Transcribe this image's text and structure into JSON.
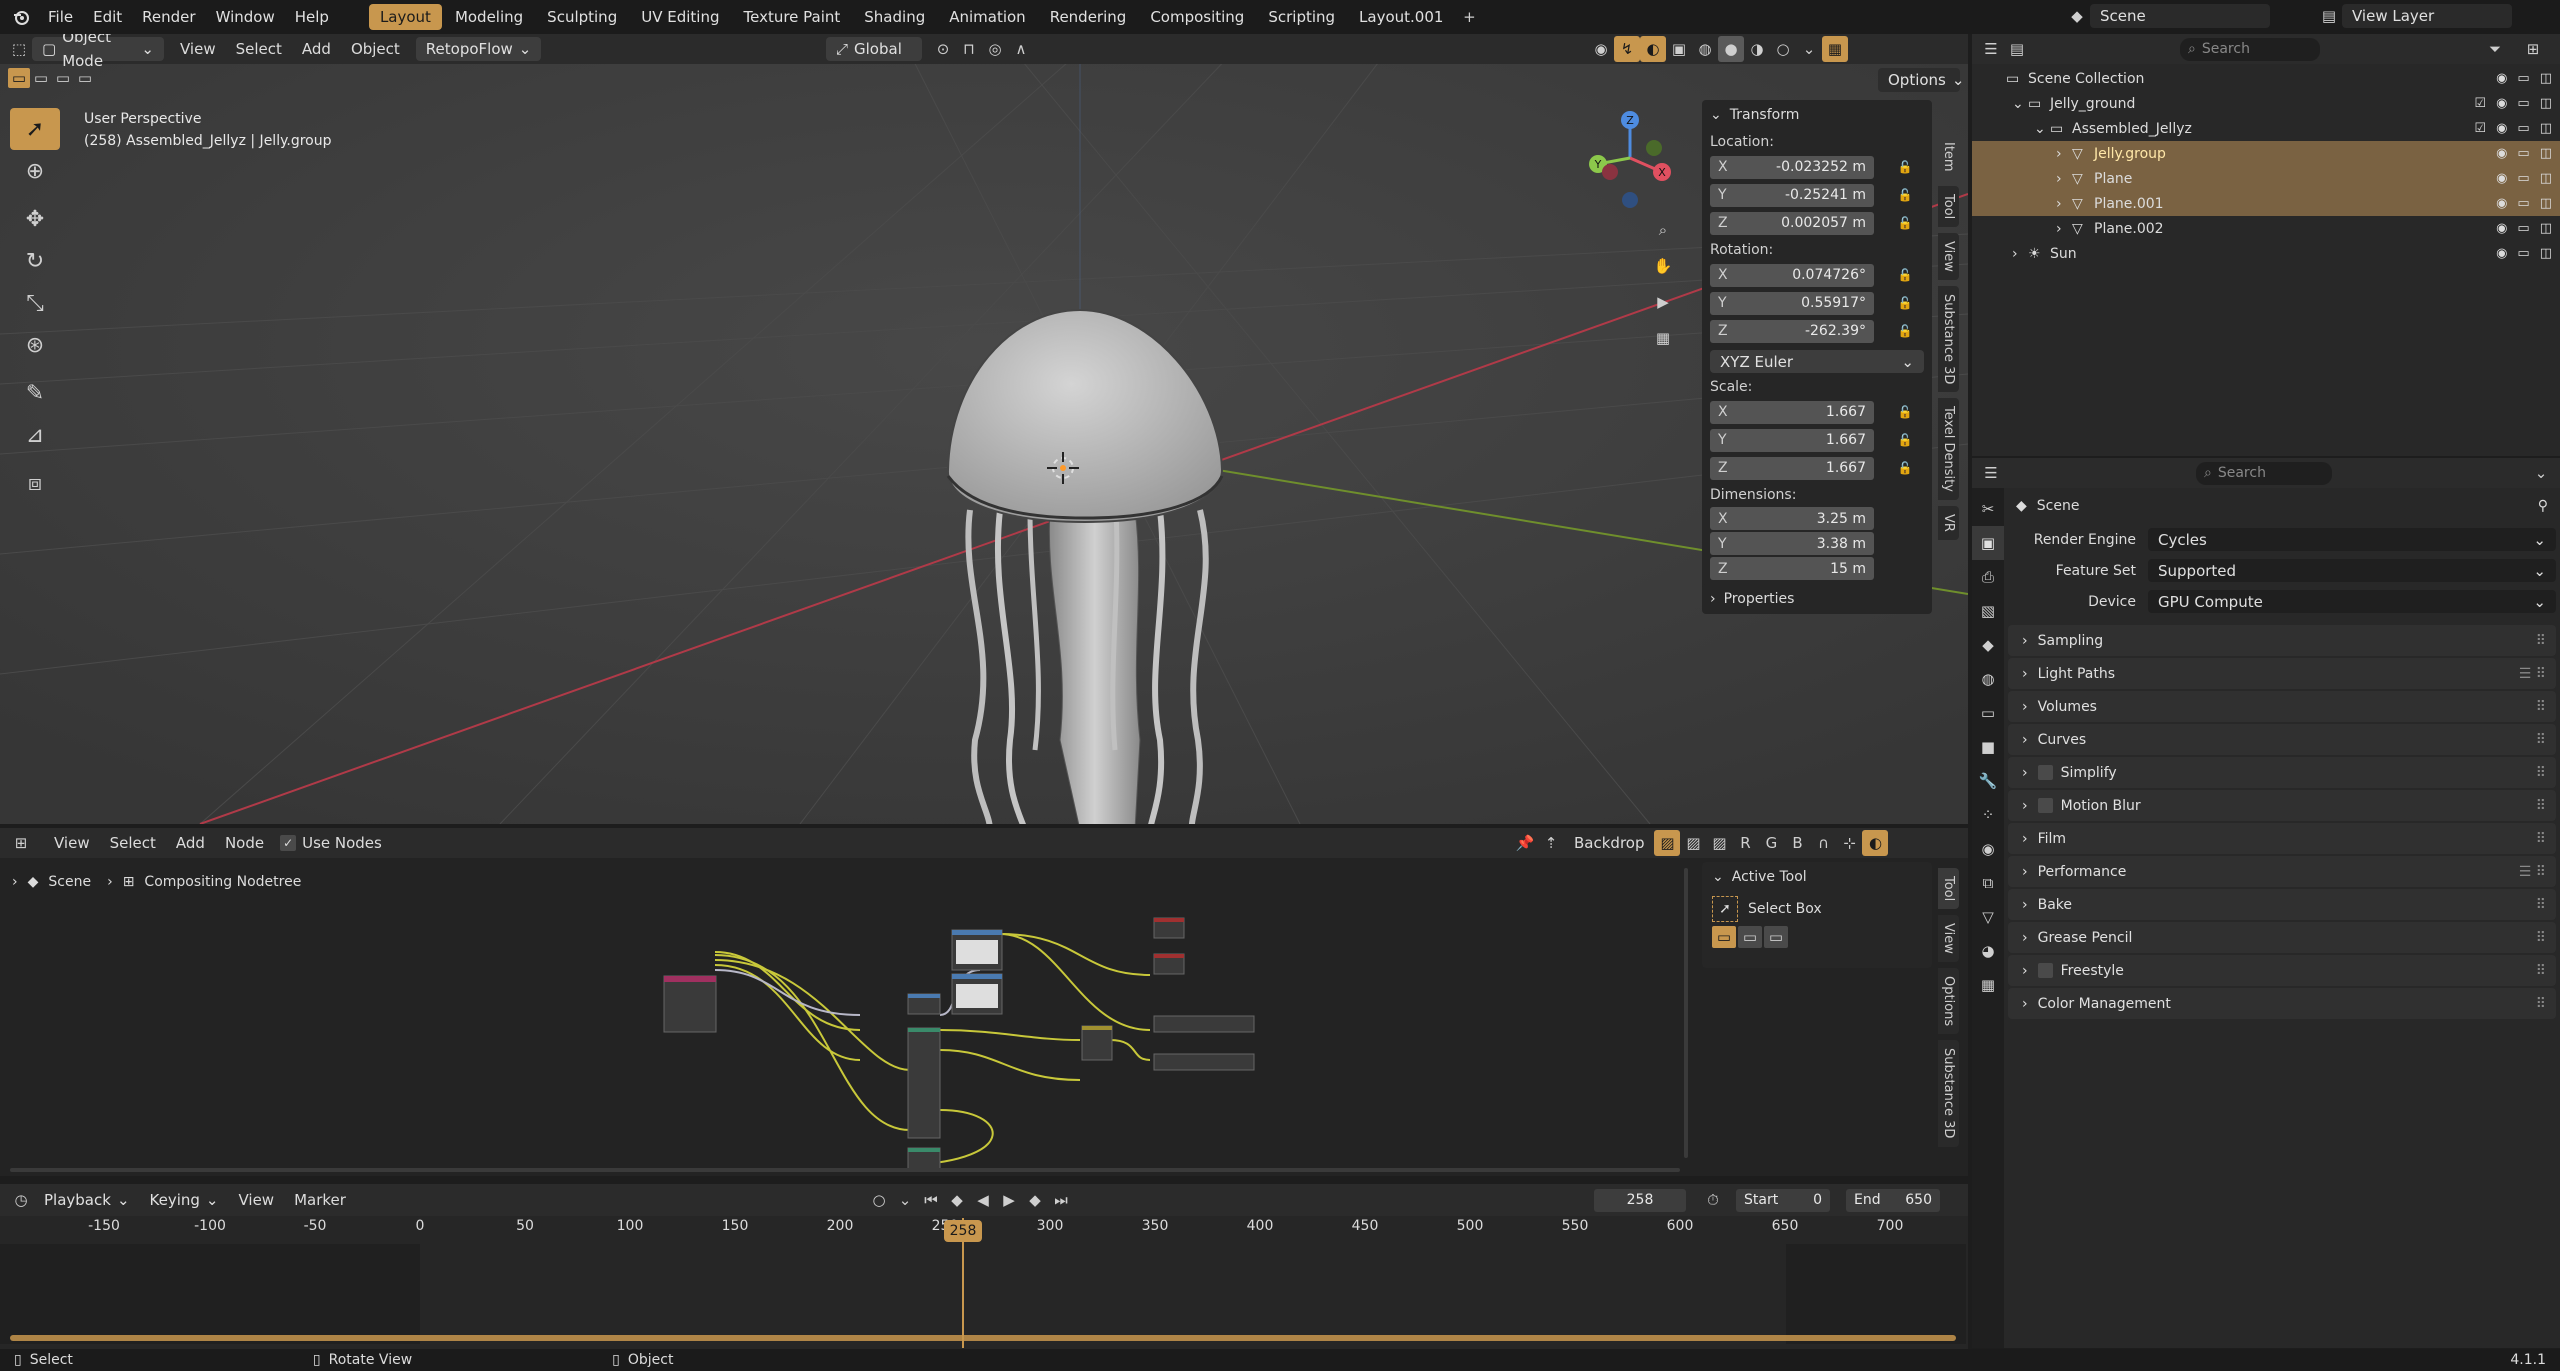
{
  "menu": [
    "File",
    "Edit",
    "Render",
    "Window",
    "Help"
  ],
  "workspaces": [
    "Layout",
    "Modeling",
    "Sculpting",
    "UV Editing",
    "Texture Paint",
    "Shading",
    "Animation",
    "Rendering",
    "Compositing",
    "Scripting",
    "Layout.001"
  ],
  "scene_selector": {
    "label": "Scene"
  },
  "viewlayer_selector": {
    "label": "View Layer"
  },
  "viewport": {
    "mode": "Object Mode",
    "menus": [
      "View",
      "Select",
      "Add",
      "Object"
    ],
    "addon_menu": "RetopoFlow",
    "orientation": "Global",
    "options": "Options",
    "info_line1": "User Perspective",
    "info_line2": "(258) Assembled_Jellyz | Jelly.group",
    "side_tabs": [
      "Item",
      "Tool",
      "View",
      "Substance 3D",
      "Texel Density",
      "VR"
    ],
    "gizmo": {
      "x": "X",
      "y": "Y",
      "z": "Z"
    }
  },
  "transform": {
    "title": "Transform",
    "location_label": "Location:",
    "location": [
      {
        "ax": "X",
        "v": "-0.023252 m"
      },
      {
        "ax": "Y",
        "v": "-0.25241 m"
      },
      {
        "ax": "Z",
        "v": "0.002057 m"
      }
    ],
    "rotation_label": "Rotation:",
    "rotation": [
      {
        "ax": "X",
        "v": "0.074726°"
      },
      {
        "ax": "Y",
        "v": "0.55917°"
      },
      {
        "ax": "Z",
        "v": "-262.39°"
      }
    ],
    "rotation_mode": "XYZ Euler",
    "scale_label": "Scale:",
    "scale": [
      {
        "ax": "X",
        "v": "1.667"
      },
      {
        "ax": "Y",
        "v": "1.667"
      },
      {
        "ax": "Z",
        "v": "1.667"
      }
    ],
    "dimensions_label": "Dimensions:",
    "dimensions": [
      {
        "ax": "X",
        "v": "3.25 m"
      },
      {
        "ax": "Y",
        "v": "3.38 m"
      },
      {
        "ax": "Z",
        "v": "15 m"
      }
    ],
    "properties": "Properties"
  },
  "outliner": {
    "search_placeholder": "Search",
    "items": [
      {
        "label": "Scene Collection",
        "indent": 0
      },
      {
        "label": "Jelly_ground",
        "indent": 1
      },
      {
        "label": "Assembled_Jellyz",
        "indent": 2
      },
      {
        "label": "Jelly.group",
        "indent": 3,
        "selected": true,
        "active": true
      },
      {
        "label": "Plane",
        "indent": 3,
        "selected": true
      },
      {
        "label": "Plane.001",
        "indent": 3,
        "selected": true
      },
      {
        "label": "Plane.002",
        "indent": 3
      },
      {
        "label": "Sun",
        "indent": 1
      }
    ]
  },
  "properties": {
    "search_placeholder": "Search",
    "context": "Scene",
    "render_engine_label": "Render Engine",
    "render_engine": "Cycles",
    "feature_set_label": "Feature Set",
    "feature_set": "Supported",
    "device_label": "Device",
    "device": "GPU Compute",
    "panels": [
      "Sampling",
      "Light Paths",
      "Volumes",
      "Curves",
      "Simplify",
      "Motion Blur",
      "Film",
      "Performance",
      "Bake",
      "Grease Pencil",
      "Freestyle",
      "Color Management"
    ]
  },
  "node_editor": {
    "menus": [
      "View",
      "Select",
      "Add",
      "Node"
    ],
    "use_nodes": "Use Nodes",
    "backdrop": "Backdrop",
    "breadcrumb_scene": "Scene",
    "breadcrumb_tree": "Compositing Nodetree",
    "active_tool_title": "Active Tool",
    "active_tool": "Select Box",
    "side_tabs": [
      "Tool",
      "View",
      "Options",
      "Substance 3D"
    ],
    "rgb": [
      "R",
      "G",
      "B"
    ]
  },
  "timeline": {
    "menus": [
      "Playback",
      "Keying",
      "View",
      "Marker"
    ],
    "current_frame": "258",
    "start_label": "Start",
    "start": "0",
    "end_label": "End",
    "end": "650",
    "ticks": [
      "-150",
      "-100",
      "-50",
      "0",
      "50",
      "100",
      "150",
      "200",
      "250",
      "300",
      "350",
      "400",
      "450",
      "500",
      "550",
      "600",
      "650",
      "700"
    ],
    "playhead": "258"
  },
  "statusbar": {
    "select": "Select",
    "rotate": "Rotate View",
    "object": "Object",
    "version": "4.1.1"
  },
  "colors": {
    "accent": "#c8974e",
    "selected_row": "#7a6242",
    "axis_x": "#e05060",
    "axis_y": "#8cc84b",
    "axis_z": "#4e8ce0"
  }
}
